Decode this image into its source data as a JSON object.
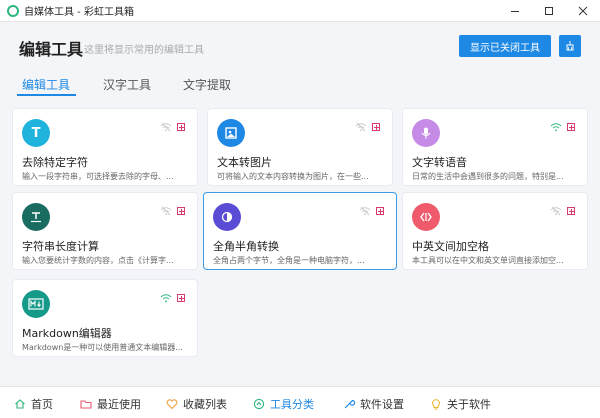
{
  "window": {
    "title": "自媒体工具 - 彩虹工具箱"
  },
  "header": {
    "title": "编辑工具",
    "subtitle": "这里将显示常用的编辑工具",
    "toggle_label": "显示已关闭工具"
  },
  "tabs": [
    {
      "label": "编辑工具"
    },
    {
      "label": "汉字工具"
    },
    {
      "label": "文字提取"
    }
  ],
  "cards": [
    {
      "title": "去除特定字符",
      "desc": "输入一段字符串，可选择要去除的字母、...",
      "icon_letter": "T",
      "icon": "text-t-icon",
      "color": "#1fb3de",
      "wifi": "offline"
    },
    {
      "title": "文本转图片",
      "desc": "可将输入的文本内容转换为图片，在一些...",
      "icon_letter": "",
      "icon": "image-icon",
      "color": "#1e88e5",
      "wifi": "offline"
    },
    {
      "title": "文字转语音",
      "desc": "日常的生活中会遇到很多的问题，特别是...",
      "icon_letter": "",
      "icon": "microphone-icon",
      "color": "#c58be6",
      "wifi": "online"
    },
    {
      "title": "字符串长度计算",
      "desc": "输入您要统计字数的内容，点击《计算字...",
      "icon_letter": "",
      "icon": "text-width-icon",
      "color": "#1a6b60",
      "wifi": "offline"
    },
    {
      "title": "全角半角转换",
      "desc": "全角占两个字节，全角是一种电脑字符，...",
      "icon_letter": "",
      "icon": "half-moon-icon",
      "color": "#5b4cd6",
      "wifi": "offline"
    },
    {
      "title": "中英文间加空格",
      "desc": "本工具可以在中文和英文单词直接添加空...",
      "icon_letter": "",
      "icon": "code-spacing-icon",
      "color": "#ef5b6c",
      "wifi": "offline"
    },
    {
      "title": "Markdown编辑器",
      "desc": "Markdown是一种可以使用普通文本编辑器...",
      "icon_letter": "",
      "icon": "markdown-icon",
      "color": "#159a8a",
      "wifi": "online"
    }
  ],
  "nav": [
    {
      "label": "首页",
      "icon": "home-icon"
    },
    {
      "label": "最近使用",
      "icon": "folder-icon"
    },
    {
      "label": "收藏列表",
      "icon": "heart-icon"
    },
    {
      "label": "工具分类",
      "icon": "category-icon"
    },
    {
      "label": "软件设置",
      "icon": "wrench-icon"
    },
    {
      "label": "关于软件",
      "icon": "bulb-icon"
    }
  ],
  "colors": {
    "accent": "#1e88e5",
    "offline": "#c9c9c9",
    "online": "#2fb67c",
    "flag": "#d83b6c"
  }
}
